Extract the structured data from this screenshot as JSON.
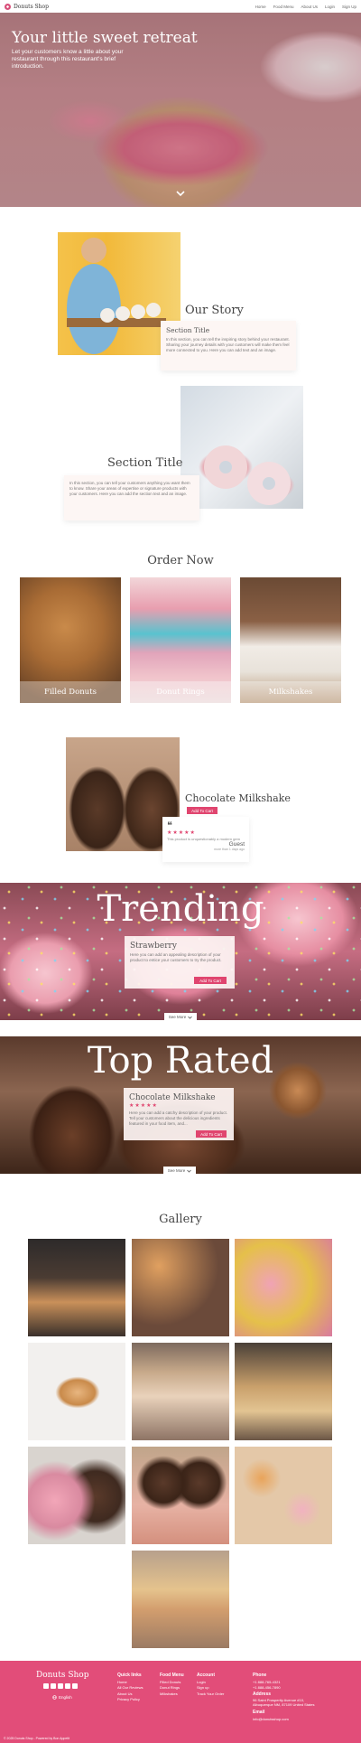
{
  "nav": {
    "brand": "Donuts Shop",
    "links": [
      "Home",
      "Food Menu",
      "About Us",
      "Login",
      "Sign Up"
    ]
  },
  "hero": {
    "title": "Your little sweet retreat",
    "subtitle": "Let your customers know a little about your restaurant through this restaurant's brief introduction."
  },
  "story": {
    "heading": "Our Story",
    "panel_title": "Section Title",
    "panel_text": "In this section, you can tell the inspiring story behind your restaurant. Sharing your journey details with your customers will make them feel more connected to you. Here you can add text and an image."
  },
  "section2": {
    "heading": "Section Title",
    "panel_text": "In this section, you can tell your customers anything you want them to know. Share your areas of expertise or signature products with your customers. Here you can add the section text and an image."
  },
  "order": {
    "heading": "Order Now",
    "cards": [
      "Filled Donuts",
      "Donut Rings",
      "Milkshakes"
    ]
  },
  "featured": {
    "name": "Chocolate Milkshake",
    "button": "Add To Cart",
    "review": {
      "stars": "★★★★★",
      "text": "This product is unquestionably a modern gem",
      "name": "Guest",
      "date": "more than 1 days ago"
    }
  },
  "trending": {
    "title": "Trending",
    "name": "Strawberry",
    "description": "Here you can add an appealing description of your product to entice your customers to try the product.",
    "button": "Add To Cart",
    "see_more": "See More"
  },
  "top_rated": {
    "title": "Top Rated",
    "name": "Chocolate Milkshake",
    "stars": "★★★★★",
    "description": "Here you can add a catchy description of your product. Tell your customers about the delicious ingredients featured in your food item, and...",
    "button": "Add To Cart",
    "see_more": "See More"
  },
  "gallery": {
    "heading": "Gallery"
  },
  "footer": {
    "brand": "Donuts Shop",
    "language": "English",
    "quick_links": {
      "heading": "Quick links",
      "items": [
        "Home",
        "All Our Reviews",
        "About Us",
        "Privacy Policy"
      ]
    },
    "food_menu": {
      "heading": "Food Menu",
      "items": [
        "Filled Donuts",
        "Donut Rings",
        "Milkshakes"
      ]
    },
    "account": {
      "heading": "Account",
      "items": [
        "Login",
        "Sign up",
        "Track Your Order"
      ]
    },
    "phone": {
      "heading": "Phone",
      "items": [
        "+1 888-765-4321",
        "+1 888-456-7890"
      ]
    },
    "address": {
      "heading": "Address",
      "items": [
        "96 Saint Prosperity Avenue #10, Albuquerque NM, 87109 United States"
      ]
    },
    "email": {
      "heading": "Email",
      "items": [
        "info@donutsshop.com"
      ]
    },
    "copyright": "© 2025 Donuts Shop - Powered by Bon Appetit"
  },
  "colors": {
    "accent": "#e0456f",
    "footer_bg": "#e24d79",
    "panel_bg": "#fdf6f4"
  },
  "icons": {
    "chevron": "chevron-down-icon",
    "quote": "quote-icon",
    "globe": "globe-icon"
  }
}
